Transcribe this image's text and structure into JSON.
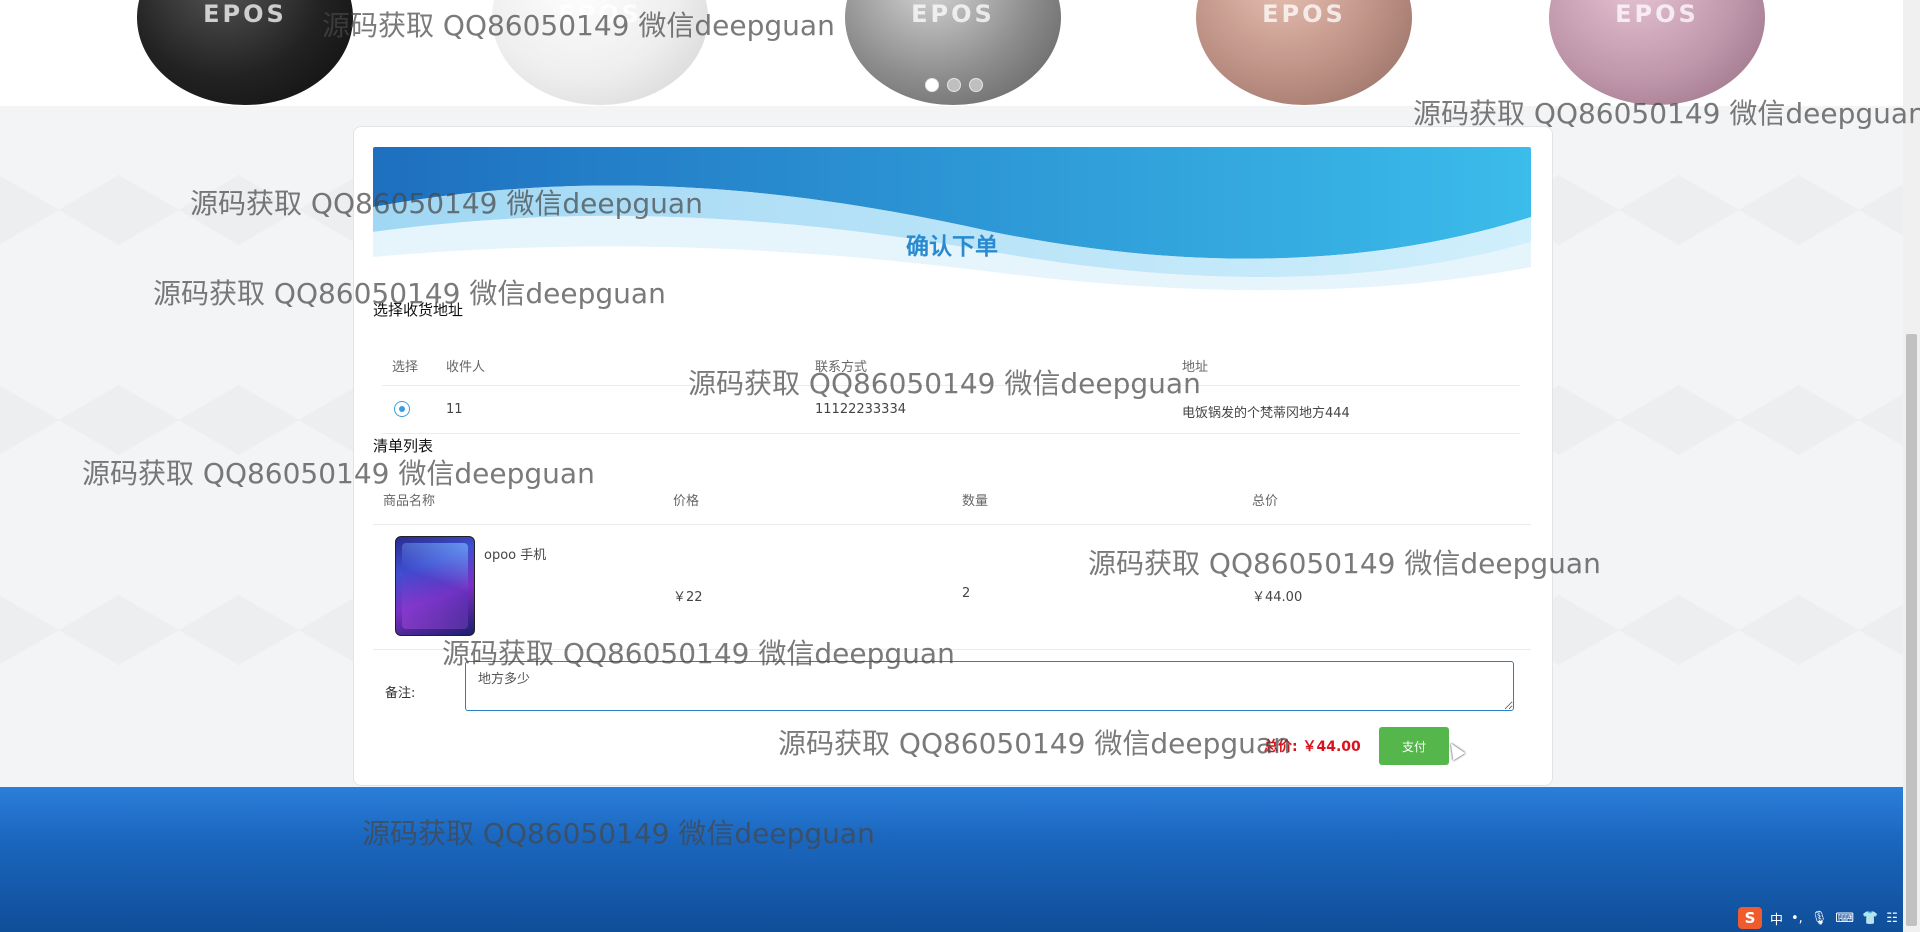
{
  "carousel": {
    "brand_text": "EPOS",
    "dot_count": 3,
    "active_index": 0
  },
  "banner": {
    "title": "确认下单"
  },
  "address_section": {
    "title": "选择收货地址",
    "columns": [
      "选择",
      "收件人",
      "联系方式",
      "地址"
    ],
    "rows": [
      {
        "selected": true,
        "recipient": "11",
        "phone": "11122233334",
        "address": "电饭锅发的个梵蒂冈地方444"
      }
    ]
  },
  "items_section": {
    "title": "清单列表",
    "columns": [
      "商品名称",
      "价格",
      "数量",
      "总价"
    ],
    "rows": [
      {
        "name": "opoo 手机",
        "price": "￥22",
        "quantity": "2",
        "subtotal": "￥44.00"
      }
    ]
  },
  "remark": {
    "label": "备注:",
    "value": "地方多少"
  },
  "order_total": {
    "label": "总价:",
    "amount": "￥44.00"
  },
  "pay_button": {
    "label": "支付"
  },
  "ime_toolbar": {
    "logo": "S",
    "mode": "中",
    "punct": "•,",
    "mic": "🎙",
    "keyboard": "⌨",
    "skin": "👕",
    "menu": "☷"
  },
  "watermark": "源码获取 QQ86050149 微信deepguan",
  "colors": {
    "accent": "#2a8ad0",
    "price_red": "#d9121b",
    "pay_green": "#55b74b",
    "footer_blue": "#1b67bf"
  }
}
